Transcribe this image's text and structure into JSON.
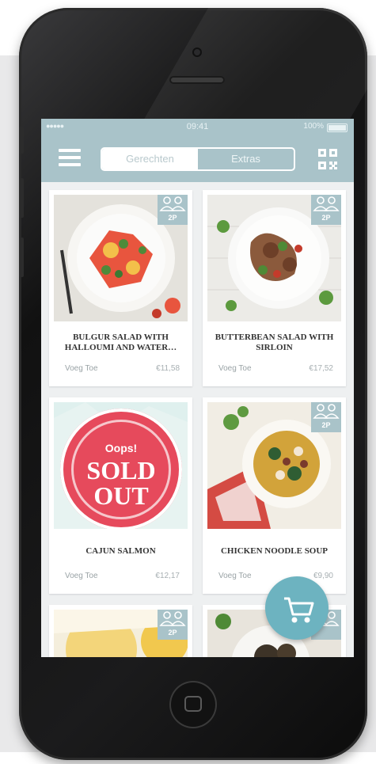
{
  "status_bar": {
    "signal": "●●●●● ",
    "time": "09:41",
    "battery": "100%"
  },
  "nav": {
    "tabs": [
      {
        "label": "Gerechten",
        "active": true
      },
      {
        "label": "Extras",
        "active": false
      }
    ],
    "colors": {
      "nav": "#a9c3c9",
      "accent": "#6db3c0",
      "sold_out": "#e64a5c"
    }
  },
  "products": [
    {
      "name": "BULGUR SALAD WITH HALLOUMI AND WATER…",
      "add_label": "Voeg Toe",
      "price": "€11,58",
      "badge": "2P"
    },
    {
      "name": "BUTTERBEAN SALAD WITH SIRLOIN",
      "add_label": "Voeg Toe",
      "price": "€17,52",
      "badge": "2P"
    },
    {
      "name": "CAJUN SALMON",
      "add_label": "Voeg Toe",
      "price": "€12,17",
      "sold_out": {
        "oops": "Oops!",
        "line1": "SOLD",
        "line2": "OUT"
      }
    },
    {
      "name": "CHICKEN NOODLE SOUP",
      "add_label": "Voeg Toe",
      "price": "€9,90",
      "badge": "2P"
    },
    {
      "badge": "2P"
    },
    {
      "badge": ""
    }
  ],
  "icons": [
    "menu-icon",
    "qr-code-icon",
    "persons-icon",
    "cart-icon"
  ]
}
